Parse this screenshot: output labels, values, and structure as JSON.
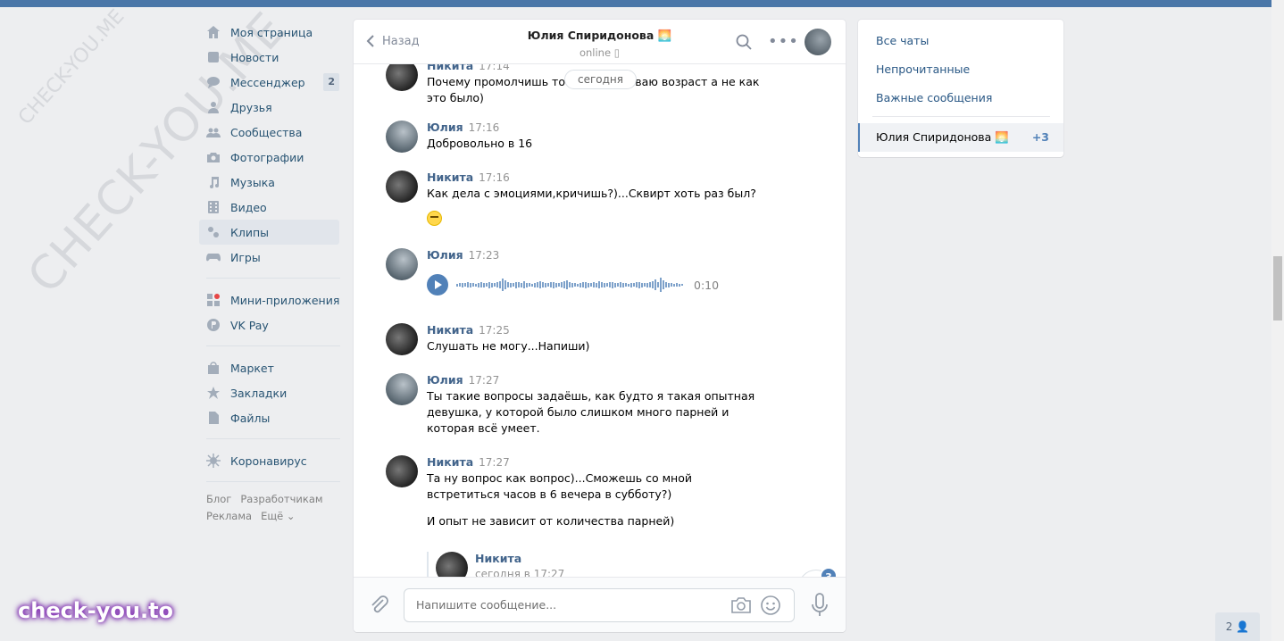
{
  "watermark": {
    "big": "CHECK-YOU.ME",
    "small": "CHECK-YOU.ME",
    "brand": "check-you.to"
  },
  "sidebar": {
    "items": [
      {
        "label": "Моя страница",
        "icon": "home-icon"
      },
      {
        "label": "Новости",
        "icon": "news-icon"
      },
      {
        "label": "Мессенджер",
        "icon": "messenger-icon",
        "badge": "2"
      },
      {
        "label": "Друзья",
        "icon": "friends-icon"
      },
      {
        "label": "Сообщества",
        "icon": "groups-icon"
      },
      {
        "label": "Фотографии",
        "icon": "camera-icon"
      },
      {
        "label": "Музыка",
        "icon": "music-icon"
      },
      {
        "label": "Видео",
        "icon": "video-icon"
      },
      {
        "label": "Клипы",
        "icon": "clips-icon",
        "active": true
      },
      {
        "label": "Игры",
        "icon": "gamepad-icon"
      },
      {
        "label": "Мини-приложения",
        "icon": "apps-icon"
      },
      {
        "label": "VK Pay",
        "icon": "vkpay-icon"
      },
      {
        "label": "Маркет",
        "icon": "market-icon"
      },
      {
        "label": "Закладки",
        "icon": "star-icon"
      },
      {
        "label": "Файлы",
        "icon": "file-icon"
      },
      {
        "label": "Коронавирус",
        "icon": "virus-icon"
      }
    ],
    "footer": [
      "Блог",
      "Разработчикам",
      "Реклама",
      "Ещё ⌄"
    ]
  },
  "chat": {
    "back_label": "Назад",
    "peer_name": "Юлия Спиридонова 🌅",
    "peer_status": "online ▯",
    "date_pill": "сегодня",
    "messages": [
      {
        "author": "Никита",
        "time": "17:14",
        "text": "Почему промолчишь то?) Я спрашиваю возраст а не как это было)"
      },
      {
        "author": "Юлия",
        "time": "17:16",
        "text": "Добровольно в 16"
      },
      {
        "author": "Никита",
        "time": "17:16",
        "text": "Как дела с эмоциями,кричишь?)...Сквирт хоть раз был?"
      },
      {
        "author": "Юлия",
        "time": "17:23",
        "voice_duration": "0:10"
      },
      {
        "author": "Никита",
        "time": "17:25",
        "text": "Слушать не могу...Напиши)"
      },
      {
        "author": "Юлия",
        "time": "17:27",
        "text": "Ты такие вопросы задаёшь, как будто я такая опытная девушка, у которой было слишком много парней и которая всё умеет."
      },
      {
        "author": "Никита",
        "time": "17:27",
        "text": "Та ну вопрос как вопрос)...Сможешь со мной встретиться часов в 6 вечера в субботу?)",
        "text2": "И опыт не зависит от количества парней)"
      }
    ],
    "forward": {
      "name": "Никита",
      "sub": "сегодня в 17:27"
    },
    "unread_badge": "3",
    "composer_placeholder": "Напишите сообщение..."
  },
  "right_panel": {
    "all_chats": "Все чаты",
    "unread": "Непрочитанные",
    "important": "Важные сообщения",
    "active_chat": "Юлия Спиридонова 🌅",
    "active_count": "+3"
  },
  "people_button": "2 👤",
  "colors": {
    "accent": "#5181b8",
    "link": "#2a5885",
    "bg": "#edeef0"
  }
}
